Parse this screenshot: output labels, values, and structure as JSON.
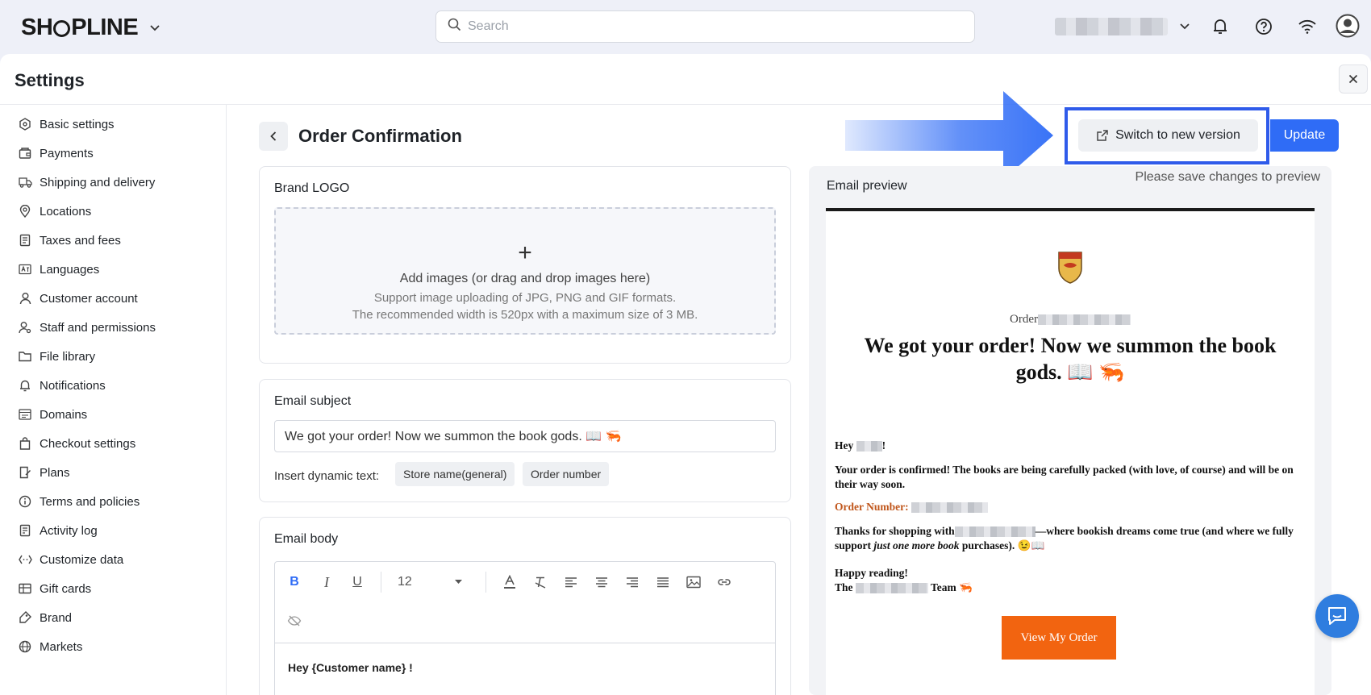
{
  "header": {
    "logo_prefix": "SH",
    "logo_suffix": "PLINE",
    "search_placeholder": "Search"
  },
  "settings": {
    "title": "Settings"
  },
  "sidebar": {
    "items": [
      {
        "label": "Basic settings",
        "icon": "hexagon-icon"
      },
      {
        "label": "Payments",
        "icon": "wallet-icon"
      },
      {
        "label": "Shipping and delivery",
        "icon": "truck-icon"
      },
      {
        "label": "Locations",
        "icon": "location-pin-icon"
      },
      {
        "label": "Taxes and fees",
        "icon": "receipt-icon"
      },
      {
        "label": "Languages",
        "icon": "language-icon"
      },
      {
        "label": "Customer account",
        "icon": "user-icon"
      },
      {
        "label": "Staff and permissions",
        "icon": "staff-icon"
      },
      {
        "label": "File library",
        "icon": "folder-icon"
      },
      {
        "label": "Notifications",
        "icon": "bell-icon"
      },
      {
        "label": "Domains",
        "icon": "domain-icon"
      },
      {
        "label": "Checkout settings",
        "icon": "bag-icon"
      },
      {
        "label": "Plans",
        "icon": "plans-icon"
      },
      {
        "label": "Terms and policies",
        "icon": "info-icon"
      },
      {
        "label": "Activity log",
        "icon": "log-icon"
      },
      {
        "label": "Customize data",
        "icon": "code-icon"
      },
      {
        "label": "Gift cards",
        "icon": "gift-card-icon"
      },
      {
        "label": "Brand",
        "icon": "brand-icon"
      },
      {
        "label": "Markets",
        "icon": "globe-icon"
      }
    ]
  },
  "page": {
    "title": "Order Confirmation",
    "switch_label": "Switch to new version",
    "update_label": "Update"
  },
  "brand_logo": {
    "title": "Brand LOGO",
    "plus": "+",
    "line1": "Add images (or drag and drop images here)",
    "line2": "Support image uploading of JPG, PNG and GIF formats.",
    "line3": "The recommended width is 520px with a maximum size of 3 MB."
  },
  "email_subject": {
    "title": "Email subject",
    "value": "We got your order! Now we summon the book gods. 📖 🦐",
    "dynamic_label": "Insert dynamic text:",
    "chips": [
      "Store name(general)",
      "Order number"
    ]
  },
  "email_body": {
    "title": "Email body",
    "font_size": "12",
    "content": "Hey {Customer name} !"
  },
  "preview": {
    "title": "Email preview",
    "hint": "Please save changes to preview",
    "order_label": "Order",
    "headline": "We got your order! Now we summon the book gods. 📖 🦐",
    "greeting_start": "Hey",
    "greeting_end": "!",
    "confirm": "Your order is confirmed! The books are being carefully packed (with love, of course) and will be on their way soon.",
    "order_number_label": "Order Number:",
    "thanks_start": "Thanks for shopping with",
    "thanks_mid": "—where bookish dreams come true (and where we fully support ",
    "thanks_italic": "just one more book",
    "thanks_end": " purchases). 😉📖",
    "happy": "Happy reading!",
    "team_start": "The",
    "team_end": "Team 🦐",
    "button": "View My Order"
  },
  "colors": {
    "accent": "#2f6cf6",
    "highlight_frame": "#2f5bea",
    "cta": "#f26410",
    "order_number": "#c0561b"
  }
}
